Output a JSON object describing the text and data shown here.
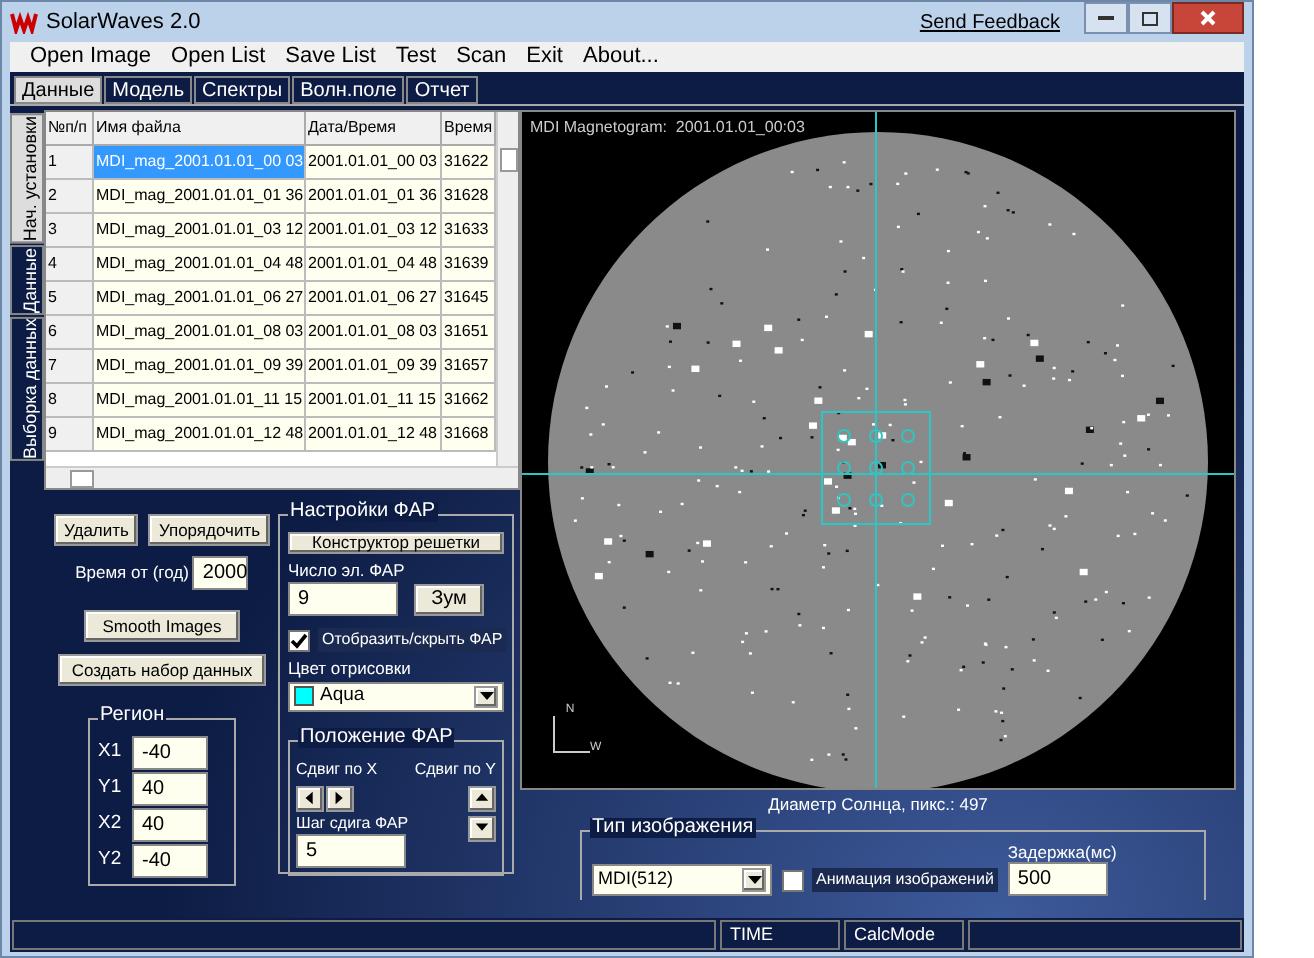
{
  "window": {
    "title": "SolarWaves 2.0",
    "feedback_link": "Send Feedback"
  },
  "menu": [
    "Open Image",
    "Open List",
    "Save List",
    "Test",
    "Scan",
    "Exit",
    "About..."
  ],
  "tabs": [
    {
      "label": "Данные",
      "selected": true
    },
    {
      "label": "Модель",
      "selected": false
    },
    {
      "label": "Спектры",
      "selected": false
    },
    {
      "label": "Волн.поле",
      "selected": false
    },
    {
      "label": "Отчет",
      "selected": false
    }
  ],
  "side_tabs": [
    {
      "label": "Нач. установки",
      "selected": true
    },
    {
      "label": "Данные",
      "selected": false
    },
    {
      "label": "Выборка данных",
      "selected": false
    }
  ],
  "table": {
    "columns": [
      "№п/п",
      "Имя файла",
      "Дата/Время",
      "Время"
    ],
    "rows": [
      {
        "cells": [
          "1",
          "MDI_mag_2001.01.01_00 03",
          "2001.01.01_00 03",
          "31622"
        ],
        "selected": true
      },
      {
        "cells": [
          "2",
          "MDI_mag_2001.01.01_01 36",
          "2001.01.01_01 36",
          "31628"
        ],
        "selected": false
      },
      {
        "cells": [
          "3",
          "MDI_mag_2001.01.01_03 12",
          "2001.01.01_03 12",
          "31633"
        ],
        "selected": false
      },
      {
        "cells": [
          "4",
          "MDI_mag_2001.01.01_04 48",
          "2001.01.01_04 48",
          "31639"
        ],
        "selected": false
      },
      {
        "cells": [
          "5",
          "MDI_mag_2001.01.01_06 27",
          "2001.01.01_06 27",
          "31645"
        ],
        "selected": false
      },
      {
        "cells": [
          "6",
          "MDI_mag_2001.01.01_08 03",
          "2001.01.01_08 03",
          "31651"
        ],
        "selected": false
      },
      {
        "cells": [
          "7",
          "MDI_mag_2001.01.01_09 39",
          "2001.01.01_09 39",
          "31657"
        ],
        "selected": false
      },
      {
        "cells": [
          "8",
          "MDI_mag_2001.01.01_11 15",
          "2001.01.01_11 15",
          "31662"
        ],
        "selected": false
      },
      {
        "cells": [
          "9",
          "MDI_mag_2001.01.01_12 48",
          "2001.01.01_12 48",
          "31668"
        ],
        "selected": false
      }
    ]
  },
  "data_buttons": {
    "delete": "Удалить",
    "sort": "Упорядочить",
    "smooth": "Smooth Images",
    "create": "Создать набор данных"
  },
  "time_from": {
    "label": "Время от (год)",
    "value": "2000"
  },
  "region": {
    "legend": "Регион",
    "fields": [
      {
        "label": "X1",
        "value": "-40"
      },
      {
        "label": "Y1",
        "value": "40"
      },
      {
        "label": "X2",
        "value": "40"
      },
      {
        "label": "Y2",
        "value": "-40"
      }
    ]
  },
  "far": {
    "legend": "Настройки ФАР",
    "builder_button": "Конструктор решетки",
    "count_label": "Число эл. ФАР",
    "count_value": "9",
    "zoom_button": "Зум",
    "show_checkbox": {
      "label": "Отобразить/скрыть ФАР",
      "checked": true
    },
    "color_label": "Цвет отрисовки",
    "color_select": {
      "value": "Aqua",
      "color": "#00ffff"
    },
    "position": {
      "legend": "Положение ФАР",
      "shift_x": "Сдвиг по X",
      "shift_y": "Сдвиг по Y",
      "step_label": "Шаг сдига ФАР",
      "step_value": "5"
    }
  },
  "image": {
    "caption": "MDI Magnetogram:  2001.01.01_00:03",
    "north": "N",
    "west": "W",
    "diameter": "Диаметр Солнца, пикс.: 497"
  },
  "image_type": {
    "legend": "Тип изображения",
    "select": "MDI(512)",
    "animation": {
      "label": "Анимация изображений",
      "checked": false
    },
    "delay_label": "Задержка(мс)",
    "delay_value": "500"
  },
  "status_bar": [
    "TIME",
    "CalcMode"
  ]
}
